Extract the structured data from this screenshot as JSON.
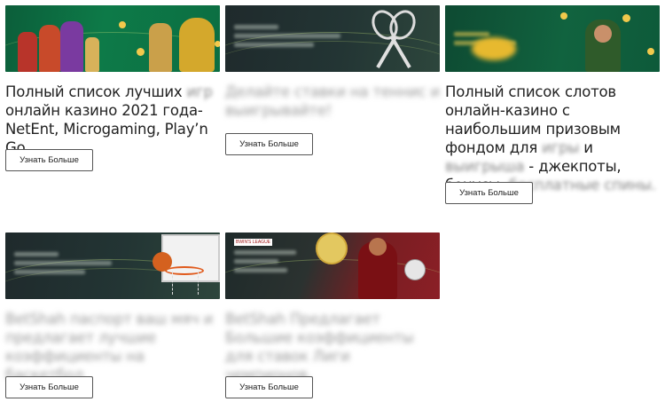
{
  "cards": [
    {
      "desc_a": "Полный список лучших ",
      "desc_blur": "игр",
      "desc_b": " онлайн казино 2021 года-NetEnt, Microgaming, Play’n Go.",
      "button": "Узнать Больше"
    },
    {
      "desc_blur": "Делайте ставки на теннис и выигрывайте!",
      "button": "Узнать Больше"
    },
    {
      "desc_a": "Полный список слотов онлайн-казино с наибольшим призовым фондом для ",
      "desc_soft1": "игры",
      "desc_b": " и ",
      "desc_soft2": "выигрыша",
      "desc_c": " - джекпоты, бонусы, ",
      "desc_soft3": "бесплатные спины.",
      "button": "Узнать Больше"
    },
    {
      "desc_blur": "BetShah паспорт ваш мяч и предлагает лучшие коэффициенты на баскетбол",
      "button": "Узнать Больше"
    },
    {
      "banner_badge": "BWIN'S LEAGUE",
      "desc_blur": "BetShah Предлагает Большие коэффициенты для ставок Лиги чемпионов.",
      "button": "Узнать Больше"
    }
  ],
  "colors": {
    "casino_green": "#0d7a48",
    "dark_banner": "#233534",
    "red_banner": "#8b1f26",
    "button_border": "#555555"
  }
}
